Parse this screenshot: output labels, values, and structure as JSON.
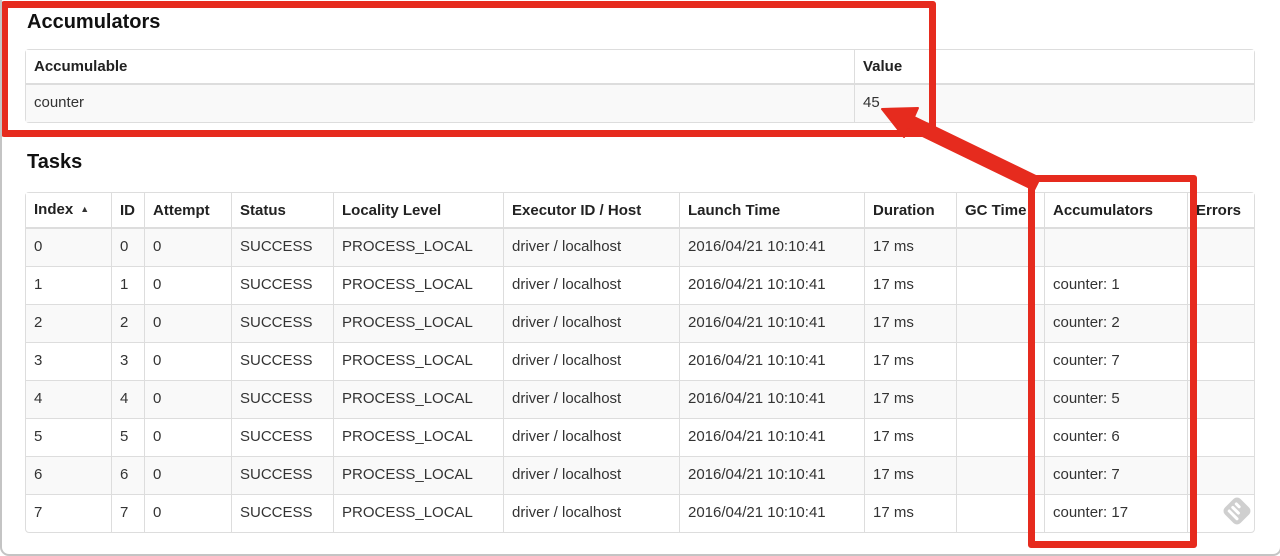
{
  "accumulators_section": {
    "heading": "Accumulators",
    "table": {
      "headers": [
        "Accumulable",
        "Value"
      ],
      "rows": [
        [
          "counter",
          "45"
        ]
      ]
    }
  },
  "tasks_section": {
    "heading": "Tasks",
    "table": {
      "headers": [
        "Index",
        "ID",
        "Attempt",
        "Status",
        "Locality Level",
        "Executor ID / Host",
        "Launch Time",
        "Duration",
        "GC Time",
        "Accumulators",
        "Errors"
      ],
      "sort_column": "Index",
      "sort_icon": "▲",
      "rows": [
        [
          "0",
          "0",
          "0",
          "SUCCESS",
          "PROCESS_LOCAL",
          "driver / localhost",
          "2016/04/21 10:10:41",
          "17 ms",
          "",
          "",
          ""
        ],
        [
          "1",
          "1",
          "0",
          "SUCCESS",
          "PROCESS_LOCAL",
          "driver / localhost",
          "2016/04/21 10:10:41",
          "17 ms",
          "",
          "counter: 1",
          ""
        ],
        [
          "2",
          "2",
          "0",
          "SUCCESS",
          "PROCESS_LOCAL",
          "driver / localhost",
          "2016/04/21 10:10:41",
          "17 ms",
          "",
          "counter: 2",
          ""
        ],
        [
          "3",
          "3",
          "0",
          "SUCCESS",
          "PROCESS_LOCAL",
          "driver / localhost",
          "2016/04/21 10:10:41",
          "17 ms",
          "",
          "counter: 7",
          ""
        ],
        [
          "4",
          "4",
          "0",
          "SUCCESS",
          "PROCESS_LOCAL",
          "driver / localhost",
          "2016/04/21 10:10:41",
          "17 ms",
          "",
          "counter: 5",
          ""
        ],
        [
          "5",
          "5",
          "0",
          "SUCCESS",
          "PROCESS_LOCAL",
          "driver / localhost",
          "2016/04/21 10:10:41",
          "17 ms",
          "",
          "counter: 6",
          ""
        ],
        [
          "6",
          "6",
          "0",
          "SUCCESS",
          "PROCESS_LOCAL",
          "driver / localhost",
          "2016/04/21 10:10:41",
          "17 ms",
          "",
          "counter: 7",
          ""
        ],
        [
          "7",
          "7",
          "0",
          "SUCCESS",
          "PROCESS_LOCAL",
          "driver / localhost",
          "2016/04/21 10:10:41",
          "17 ms",
          "",
          "counter: 17",
          ""
        ]
      ]
    }
  },
  "annotations": {
    "color": "#e62b1e",
    "items": [
      "highlight-box-around-accumulators-section",
      "highlight-box-around-accumulators-column",
      "arrow-from-accumulators-column-to-value-45"
    ]
  },
  "watermark": {
    "icon": "skitch-diamond-icon",
    "color": "#c9c9c9"
  }
}
